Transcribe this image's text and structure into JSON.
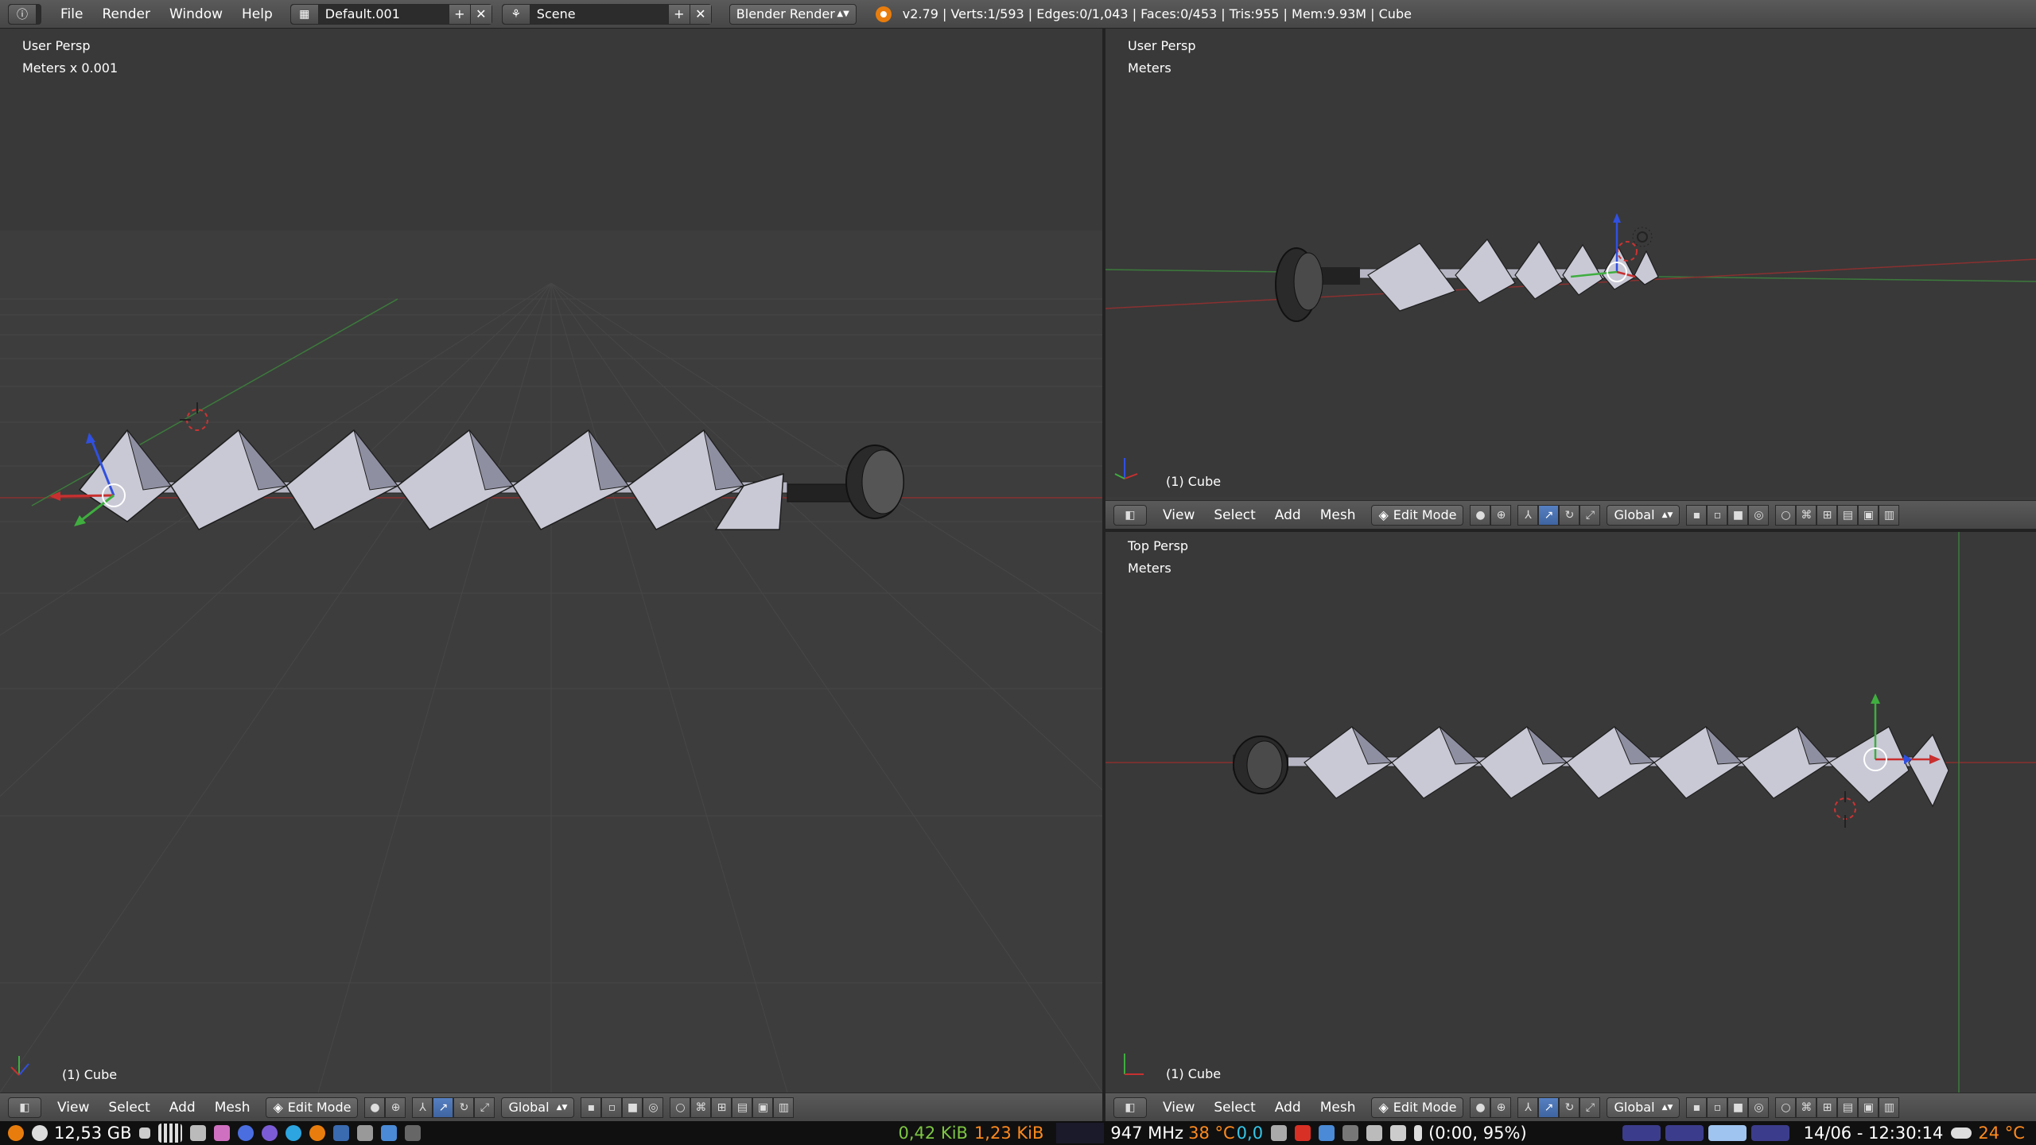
{
  "topbar": {
    "info_icon": "info-icon",
    "menus": [
      "File",
      "Render",
      "Window",
      "Help"
    ],
    "screen_layout": "Default.001",
    "scene": "Scene",
    "render_engine": "Blender Render",
    "status": "v2.79 | Verts:1/593 | Edges:0/1,043 | Faces:0/453 | Tris:955 | Mem:9.93M | Cube"
  },
  "viewports": {
    "left": {
      "view": "User Persp",
      "units": "Meters x 0.001",
      "object": "(1) Cube"
    },
    "top_right": {
      "view": "User Persp",
      "units": "Meters",
      "object": "(1) Cube"
    },
    "bottom_right": {
      "view": "Top Persp",
      "units": "Meters",
      "object": "(1) Cube"
    }
  },
  "header3d": {
    "menus": [
      "View",
      "Select",
      "Add",
      "Mesh"
    ],
    "mode": "Edit Mode",
    "orientation": "Global"
  },
  "taskbar": {
    "ram": "12,53 GB",
    "net_down": "0,42 KiB",
    "net_up": "1,23 KiB",
    "cpu_freq": "947 MHz",
    "cpu_temp": "38 °C",
    "cpu_load": "0,0",
    "battery": "(0:00, 95%)",
    "datetime": "14/06 - 12:30:14",
    "weather": "24 °C"
  },
  "colors": {
    "x_axis": "#c83030",
    "y_axis": "#3fae3f",
    "z_axis": "#3050e0",
    "accent_blue": "#5680c2",
    "blender_orange": "#e87d0d"
  }
}
